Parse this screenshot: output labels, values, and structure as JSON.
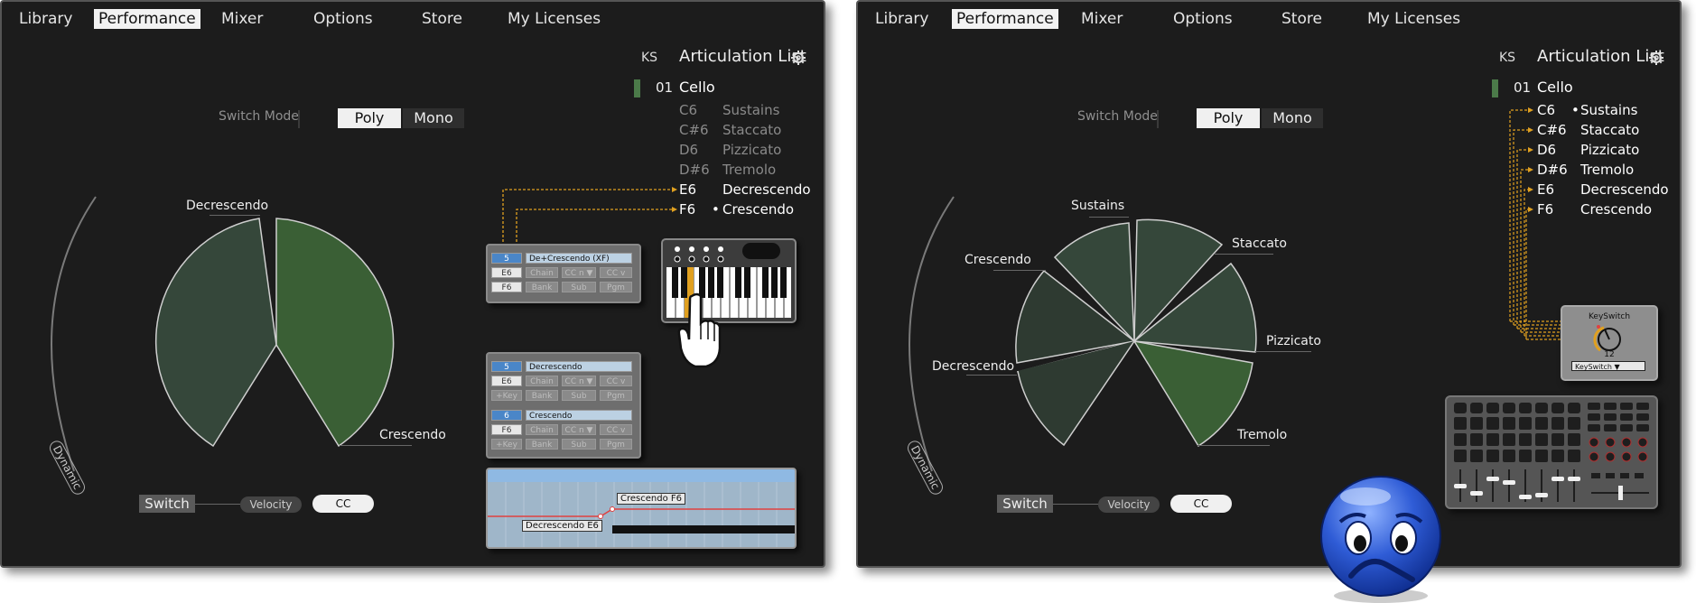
{
  "nav": [
    "Library",
    "Performance",
    "Mixer",
    "Options",
    "Store",
    "My Licenses"
  ],
  "active_tab": "Performance",
  "articulation": {
    "ks_header": "KS",
    "title": "Articulation List",
    "num": "01",
    "name": "Cello"
  },
  "left": {
    "rows": [
      {
        "ks": "C6",
        "name": "Sustains",
        "dot": ""
      },
      {
        "ks": "C#6",
        "name": "Staccato",
        "dot": ""
      },
      {
        "ks": "D6",
        "name": "Pizzicato",
        "dot": ""
      },
      {
        "ks": "D#6",
        "name": "Tremolo",
        "dot": ""
      },
      {
        "ks": "E6",
        "name": "Decrescendo",
        "dot": ""
      },
      {
        "ks": "F6",
        "name": "Crescendo",
        "dot": "•"
      }
    ],
    "slices": [
      "Decrescendo",
      "Crescendo"
    ],
    "chip1": {
      "num": "5",
      "name": "De+Crescendo (XF)",
      "note": "E6",
      "note2": "F6",
      "chain": "Chain",
      "ccn": "CC n ▼",
      "ccv": "CC v",
      "bank": "Bank",
      "sub": "Sub",
      "pgm": "Pgm"
    },
    "chip2a": {
      "num": "5",
      "name": "Decrescendo",
      "note": "E6",
      "chain": "Chain",
      "ccn": "CC n ▼",
      "ccv": "CC v",
      "key": "+Key",
      "bank": "Bank",
      "sub": "Sub",
      "pgm": "Pgm"
    },
    "chip2b": {
      "num": "6",
      "name": "Crescendo",
      "note": "F6",
      "chain": "Chain",
      "ccn": "CC n ▼",
      "ccv": "CC v",
      "key": "+Key",
      "bank": "Bank",
      "sub": "Sub",
      "pgm": "Pgm"
    },
    "timeline": {
      "label1": "Crescendo F6",
      "label2": "Decrescendo E6"
    }
  },
  "right": {
    "rows": [
      {
        "ks": "C6",
        "name": "Sustains",
        "dot": "•"
      },
      {
        "ks": "C#6",
        "name": "Staccato",
        "dot": ""
      },
      {
        "ks": "D6",
        "name": "Pizzicato",
        "dot": ""
      },
      {
        "ks": "D#6",
        "name": "Tremolo",
        "dot": ""
      },
      {
        "ks": "E6",
        "name": "Decrescendo",
        "dot": ""
      },
      {
        "ks": "F6",
        "name": "Crescendo",
        "dot": ""
      }
    ],
    "slices": [
      "Sustains",
      "Staccato",
      "Pizzicato",
      "Tremolo",
      "Decrescendo",
      "Crescendo"
    ],
    "keyswitch": {
      "title": "KeySwitch",
      "value": "12",
      "select": "KeySwitch ▼"
    }
  },
  "controls": {
    "switch_mode": "Switch Mode",
    "poly": "Poly",
    "mono": "Mono",
    "dynamic": "Dynamic",
    "switch": "Switch",
    "velocity": "Velocity",
    "cc": "CC"
  },
  "colors": {
    "accent_orange": "#e0a020",
    "slice_dark": "#35473a",
    "slice_green": "#3a5f35",
    "ks_bar": "#4b7a49",
    "chip_blue": "#4a86c8"
  }
}
